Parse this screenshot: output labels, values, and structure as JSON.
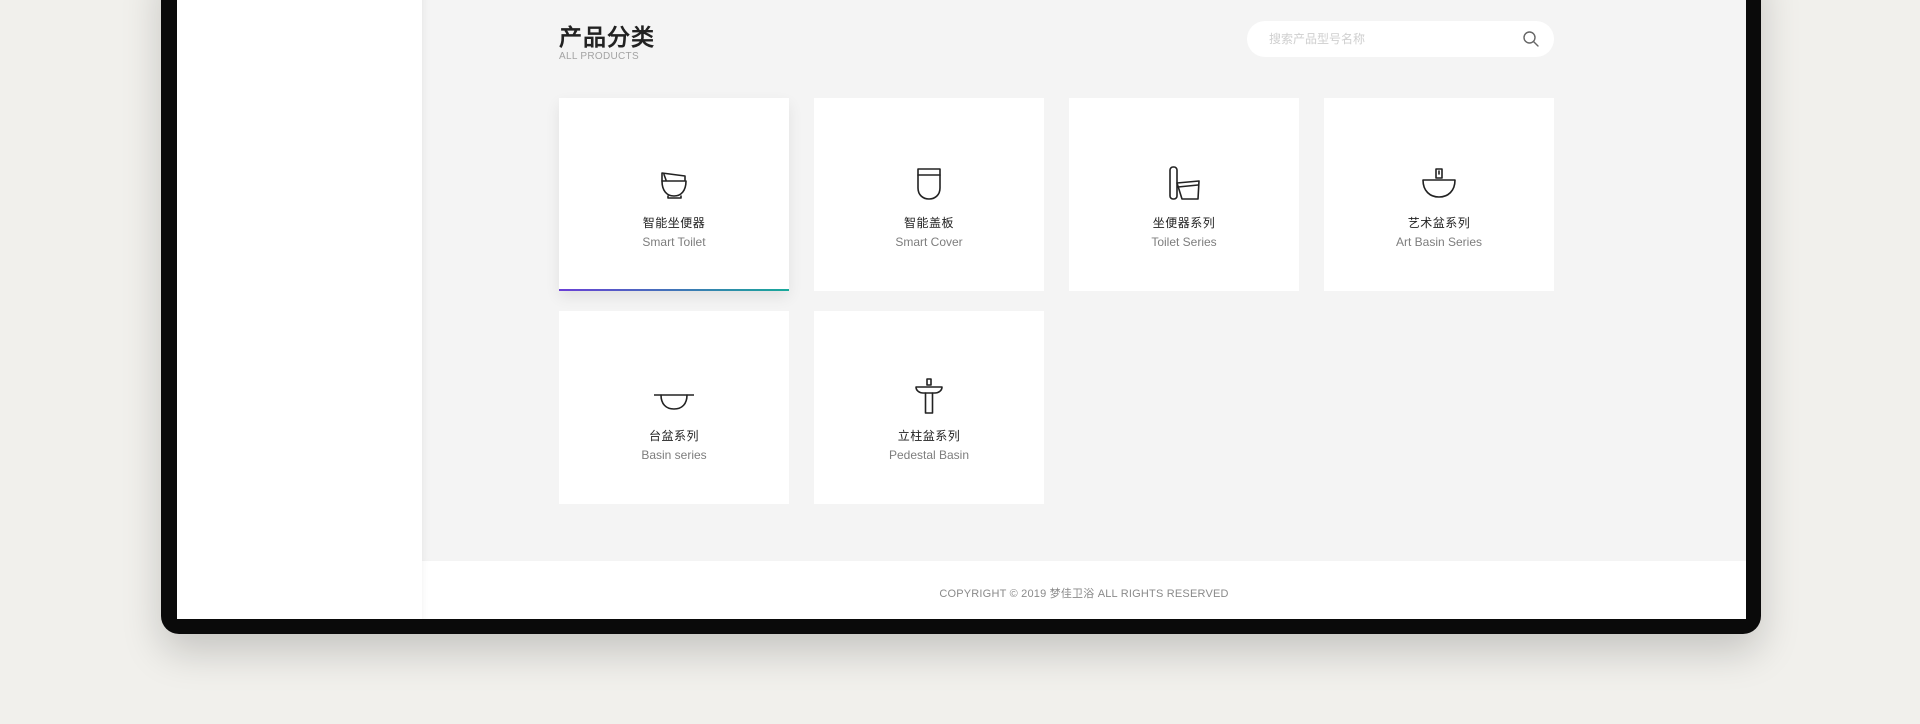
{
  "page": {
    "title": "产品分类",
    "subtitle": "ALL PRODUCTS"
  },
  "search": {
    "placeholder": "搜索产品型号名称",
    "icon": "search-icon"
  },
  "categories": [
    {
      "name_cn": "智能坐便器",
      "name_en": "Smart Toilet",
      "icon": "smart-toilet-icon",
      "active": true
    },
    {
      "name_cn": "智能盖板",
      "name_en": "Smart Cover",
      "icon": "smart-cover-icon",
      "active": false
    },
    {
      "name_cn": "坐便器系列",
      "name_en": "Toilet Series",
      "icon": "toilet-series-icon",
      "active": false
    },
    {
      "name_cn": "艺术盆系列",
      "name_en": "Art Basin Series",
      "icon": "art-basin-icon",
      "active": false
    },
    {
      "name_cn": "台盆系列",
      "name_en": "Basin series",
      "icon": "basin-icon",
      "active": false
    },
    {
      "name_cn": "立柱盆系列",
      "name_en": "Pedestal Basin",
      "icon": "pedestal-basin-icon",
      "active": false
    }
  ],
  "footer": {
    "copyright": "COPYRIGHT © 2019 梦佳卫浴 ALL RIGHTS RESERVED"
  },
  "colors": {
    "accent_start": "#6a3fd6",
    "accent_end": "#18a99a",
    "page_bg": "#f4f4f4",
    "outer_bg": "#f1f0ec"
  }
}
